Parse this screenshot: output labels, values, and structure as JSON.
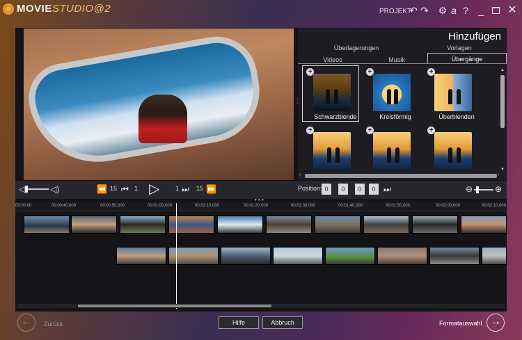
{
  "titlebar": {
    "app_name_main": "MOVIE",
    "app_name_accent": "STUDIO",
    "app_version": "2",
    "project_label": "PROJEKT",
    "icons": [
      "undo-icon",
      "redo-icon",
      "gear-icon",
      "account-icon",
      "help-icon",
      "minimize-icon",
      "maximize-icon",
      "close-icon"
    ],
    "help": "?",
    "account": "a"
  },
  "add_panel": {
    "title": "Hinzufügen",
    "tabs": [
      {
        "label": "Überlagerungen"
      },
      {
        "label": "Vorlagen"
      },
      {
        "label": "Videos"
      },
      {
        "label": "Musik"
      },
      {
        "label": "Übergänge",
        "active": true
      }
    ],
    "items": [
      {
        "label": "Schwarzblende",
        "selected": true
      },
      {
        "label": "Kreisförmig"
      },
      {
        "label": "Überblenden"
      },
      {
        "label": ""
      },
      {
        "label": ""
      },
      {
        "label": ""
      }
    ]
  },
  "transport": {
    "step_back_frames": "15",
    "step_back_single": "1",
    "step_fwd_single": "1",
    "step_fwd_frames": "15",
    "position_label": "Position:",
    "position_fields": [
      "0",
      "0",
      "0",
      "0"
    ]
  },
  "timeline": {
    "ruler": [
      "00:00:00",
      "00:00:40,000",
      "00:00:50,000",
      "00:01:00,000",
      "00:01:10,000",
      "00:01:20,000",
      "00:01:30,000",
      "00:01:40,000",
      "00:01:50,000",
      "00:02:00,000",
      "00:02:10,000"
    ]
  },
  "footer": {
    "back_label": "Zurück",
    "help_button": "Hilfe",
    "cancel_button": "Abbruch",
    "next_label": "Formatauswahl"
  },
  "colors": {
    "accent": "#f0a030",
    "panel_bg": "#1c1c22"
  }
}
